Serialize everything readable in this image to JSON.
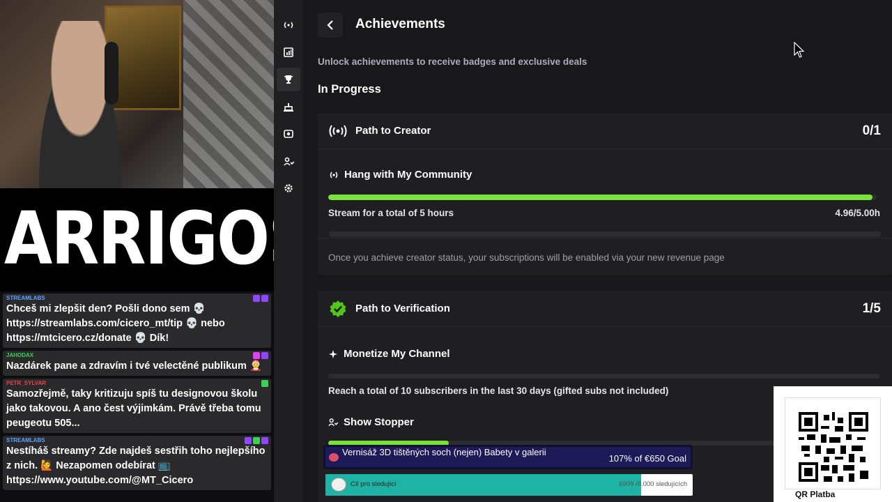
{
  "overlay": {
    "logo": "ARRIGOS",
    "chat": [
      {
        "user": "STREAMLABS",
        "user_color": "#5ea2ff",
        "body": "Chceš mi zlepšit den? Pošli dono sem 💀 https://streamlabs.com/cicero_mt/tip 💀 nebo https://mtcicero.cz/donate 💀 Dík!"
      },
      {
        "user": "JAHODAX",
        "user_color": "#39d353",
        "body": "Nazdárek pane a zdravím i tvé velectěné publikum 🤶"
      },
      {
        "user": "PETR_SYLVAR",
        "user_color": "#e84545",
        "body": "Samozřejmě, taky kritizuju spíš tu designovou školu jako takovou. A ano čest výjimkám. Právě třeba tomu peugeotu 505..."
      },
      {
        "user": "STREAMLABS",
        "user_color": "#5ea2ff",
        "body": "Nestíháš streamy? Zde najdeš sestřih toho nejlepšího z nich. 🙋 Nezapomen odebírat 📺 https://www.youtube.com/@MT_Cicero"
      }
    ],
    "goal": {
      "text": "Vernisáž 3D tištěných soch (nejen) Babety v galerii",
      "value": "107% of €650 Goal"
    },
    "follow": {
      "label": "Cíl pro sledující",
      "value": "6909 /8.000 sledujících",
      "progress": 0.86
    },
    "qr_label": "QR Platba"
  },
  "sidebar": {
    "items": [
      {
        "icon": "broadcast-icon",
        "glyph": "(•)"
      },
      {
        "icon": "chart-icon",
        "glyph": "▮"
      },
      {
        "icon": "trophy-icon",
        "glyph": "🏆"
      },
      {
        "icon": "cake-icon",
        "glyph": "▟"
      },
      {
        "icon": "camera-icon",
        "glyph": "◉"
      },
      {
        "icon": "users-icon",
        "glyph": "👥"
      },
      {
        "icon": "gear-icon",
        "glyph": "⚙"
      }
    ]
  },
  "page": {
    "title": "Achievements",
    "subtitle": "Unlock achievements to receive badges and exclusive deals",
    "section": "In Progress"
  },
  "cards": [
    {
      "title": "Path to Creator",
      "count": "0/1",
      "tasks": [
        {
          "title": "Hang with My Community",
          "desc": "Stream for a total of 5 hours",
          "value": "4.96/5.00h",
          "progress": 0.992
        }
      ],
      "note": "Once you achieve creator status, your subscriptions will be enabled via your new revenue page"
    },
    {
      "title": "Path to Verification",
      "count": "1/5",
      "tasks": [
        {
          "title": "Monetize My Channel",
          "desc": "Reach a total of 10 subscribers in the last 30 days (gifted subs not included)",
          "value": "",
          "progress": 0.0
        },
        {
          "title": "Show Stopper",
          "desc": "",
          "value": "",
          "progress": 0.27
        }
      ]
    }
  ],
  "colors": {
    "accent": "#7be03a",
    "background": "#18181a",
    "card": "#1f1f23"
  }
}
